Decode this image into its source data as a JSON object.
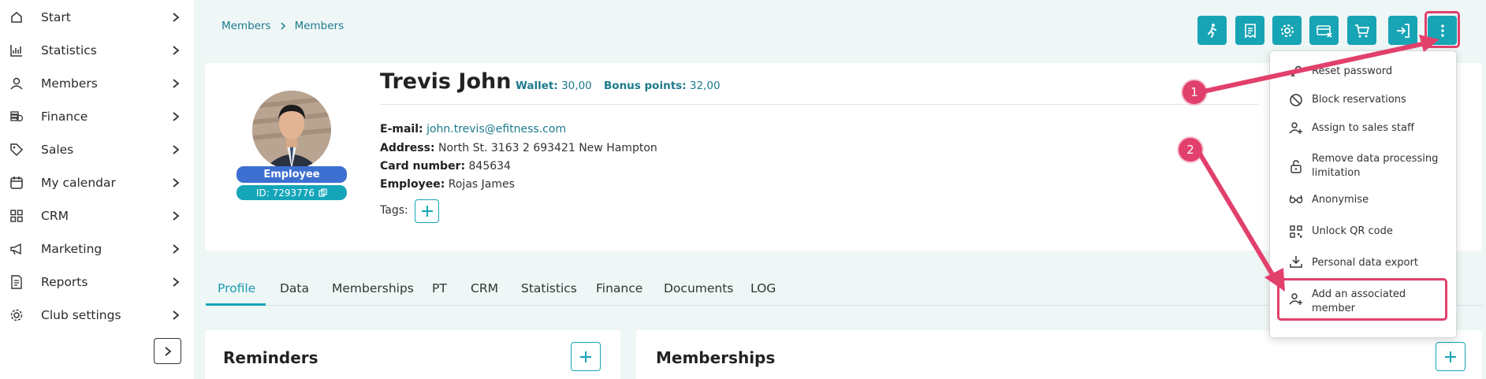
{
  "sidebar": {
    "items": [
      {
        "label": "Start",
        "icon": "home-icon"
      },
      {
        "label": "Statistics",
        "icon": "bar-chart-icon"
      },
      {
        "label": "Members",
        "icon": "user-icon"
      },
      {
        "label": "Finance",
        "icon": "coins-icon"
      },
      {
        "label": "Sales",
        "icon": "tag-icon"
      },
      {
        "label": "My calendar",
        "icon": "calendar-icon"
      },
      {
        "label": "CRM",
        "icon": "grid-icon"
      },
      {
        "label": "Marketing",
        "icon": "megaphone-icon"
      },
      {
        "label": "Reports",
        "icon": "report-icon"
      },
      {
        "label": "Club settings",
        "icon": "gear-icon"
      }
    ]
  },
  "breadcrumb": [
    "Members",
    "Members"
  ],
  "profile": {
    "name": "Trevis John",
    "wallet_label": "Wallet:",
    "wallet_value": "30,00",
    "bonus_label": "Bonus points:",
    "bonus_value": "32,00",
    "role_badge": "Employee",
    "id_badge": "ID: 7293776",
    "email_label": "E-mail:",
    "email_value": "john.trevis@efitness.com",
    "address_label": "Address:",
    "address_value": "North St. 3163 2 693421 New Hampton",
    "card_label": "Card number:",
    "card_value": "845634",
    "employee_label": "Employee:",
    "employee_value": "Rojas James",
    "tags_label": "Tags:"
  },
  "tabs": [
    "Profile",
    "Data",
    "Memberships",
    "PT",
    "CRM",
    "Statistics",
    "Finance",
    "Documents",
    "LOG"
  ],
  "sections": {
    "reminders": "Reminders",
    "memberships": "Memberships"
  },
  "dropdown": {
    "items": [
      {
        "label": "Reset password",
        "icon": "key-icon"
      },
      {
        "label": "Block reservations",
        "icon": "block-icon"
      },
      {
        "label": "Assign to sales staff",
        "icon": "user-plus-icon"
      },
      {
        "label": "Remove data processing limitation",
        "icon": "unlock-icon"
      },
      {
        "label": "Anonymise",
        "icon": "glasses-icon"
      },
      {
        "label": "Unlock QR code",
        "icon": "qr-code-icon"
      },
      {
        "label": "Personal data export",
        "icon": "download-icon"
      },
      {
        "label": "Add an associated member",
        "icon": "user-plus-icon"
      }
    ]
  },
  "annotations": {
    "step1": "1",
    "step2": "2"
  },
  "colors": {
    "accent": "#17a4b5",
    "highlight": "#e2406c",
    "employee_badge": "#3d6fd0"
  }
}
